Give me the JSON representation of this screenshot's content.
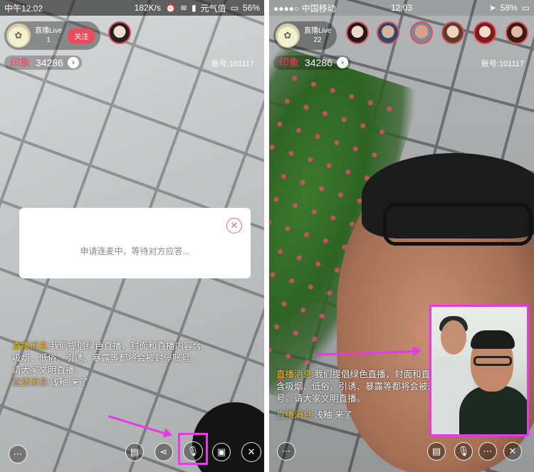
{
  "left": {
    "status": {
      "time": "中午12:02",
      "speed": "182K/s",
      "carrier": "元气值",
      "battery": "56%"
    },
    "host": {
      "name": "直播Live",
      "viewers": "1",
      "follow_label": "关注"
    },
    "score": {
      "label": "印象",
      "value": "34286"
    },
    "account": "账号:101117",
    "dialog": {
      "message": "申请连麦中，等待对方应答..."
    },
    "chat": [
      {
        "prefix": "直播消息:",
        "text": "我们提倡绿色直播，封面和直播内容含吸烟、低俗、引诱、暴露等都将会被封停账号。请大家文明直播。"
      },
      {
        "prefix": "直播消息:",
        "text": "浅釉 来了"
      }
    ]
  },
  "right": {
    "status": {
      "carrier": "●●●●○ 中国移动",
      "time": "12:03",
      "battery": "58%"
    },
    "host": {
      "name": "直播Live",
      "viewers": "22"
    },
    "score": {
      "label": "印象",
      "value": "34286"
    },
    "account": "账号:101117",
    "chat": [
      {
        "prefix": "直播消息:",
        "text": "我们提倡绿色直播，封面和直播内容含吸烟、低俗、引诱、暴露等都将会被封停账号。请大家文明直播。"
      },
      {
        "prefix": "直播消息:",
        "text": "浅釉 来了"
      }
    ]
  },
  "icons": {
    "more": "⋯",
    "chat": "▤",
    "share": "⋖",
    "mic": "🎙",
    "gift": "▣",
    "close": "✕",
    "chevron": "›"
  },
  "colors": {
    "highlight": "#e63ae6",
    "accent": "#e94d5b",
    "chat_prefix": "#f2c94c"
  }
}
